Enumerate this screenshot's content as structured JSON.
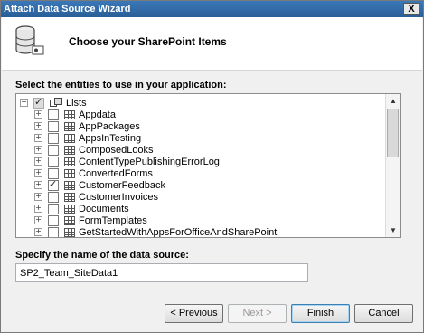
{
  "window": {
    "title": "Attach Data Source Wizard",
    "close_label": "X"
  },
  "header": {
    "title": "Choose your SharePoint Items",
    "icon": "database-icon"
  },
  "entities_label": "Select the entities to use in your application:",
  "tree": {
    "root_label": "Lists",
    "items": [
      {
        "label": "Appdata",
        "checked": false
      },
      {
        "label": "AppPackages",
        "checked": false
      },
      {
        "label": "AppsInTesting",
        "checked": false
      },
      {
        "label": "ComposedLooks",
        "checked": false
      },
      {
        "label": "ContentTypePublishingErrorLog",
        "checked": false
      },
      {
        "label": "ConvertedForms",
        "checked": false
      },
      {
        "label": "CustomerFeedback",
        "checked": true
      },
      {
        "label": "CustomerInvoices",
        "checked": false
      },
      {
        "label": "Documents",
        "checked": false
      },
      {
        "label": "FormTemplates",
        "checked": false
      },
      {
        "label": "GetStartedWithAppsForOfficeAndSharePoint",
        "checked": false
      }
    ]
  },
  "datasource": {
    "label": "Specify the name of the data source:",
    "value": "SP2_Team_SiteData1"
  },
  "buttons": {
    "previous": "< Previous",
    "next": "Next >",
    "finish": "Finish",
    "cancel": "Cancel"
  }
}
